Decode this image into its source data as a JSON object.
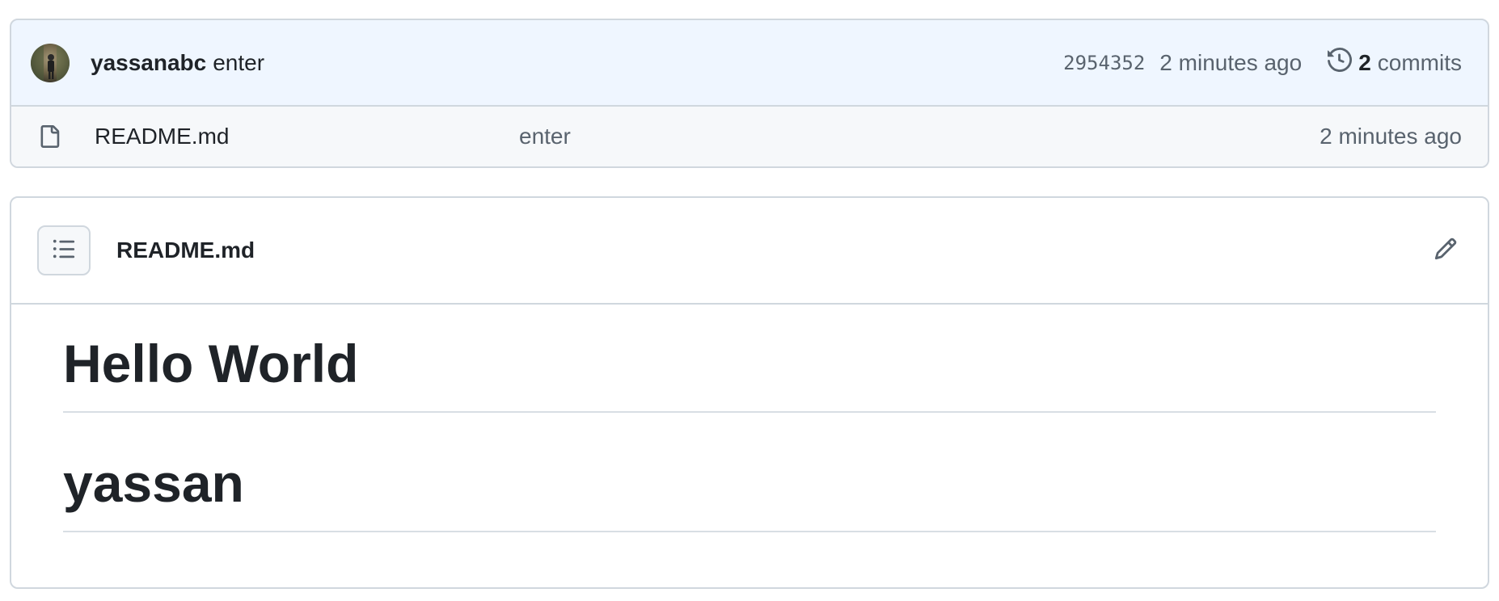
{
  "commit": {
    "author": "yassanabc",
    "message": "enter",
    "sha": "2954352",
    "time": "2 minutes ago",
    "commits_count": "2",
    "commits_label": "commits"
  },
  "files": [
    {
      "name": "README.md",
      "message": "enter",
      "time": "2 minutes ago",
      "icon": "file-icon"
    }
  ],
  "readme": {
    "title": "README.md",
    "headings": [
      "Hello World",
      "yassan"
    ]
  },
  "icons": {
    "history": "history-icon",
    "outline": "list-unordered-icon",
    "edit": "pencil-icon"
  },
  "colors": {
    "commit_row_bg": "#eff6ff",
    "muted_text": "#59636e",
    "border": "#d0d7de"
  }
}
